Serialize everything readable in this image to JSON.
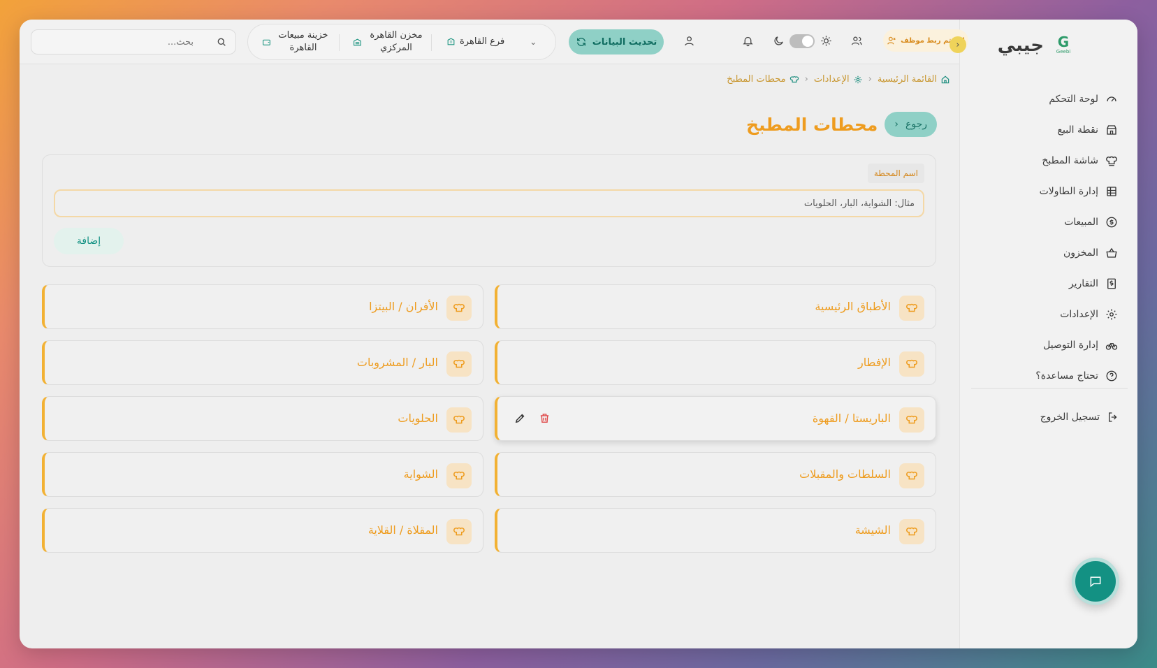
{
  "sidebar": {
    "brand": "جيبي",
    "logo_text": "Geebi",
    "items": [
      {
        "label": "لوحة التحكم",
        "icon": "gauge-icon"
      },
      {
        "label": "نقطة البيع",
        "icon": "store-icon"
      },
      {
        "label": "شاشة المطبخ",
        "icon": "chef-hat-icon"
      },
      {
        "label": "إدارة الطاولات",
        "icon": "table-icon"
      },
      {
        "label": "المبيعات",
        "icon": "dollar-circle-icon"
      },
      {
        "label": "المخزون",
        "icon": "basket-icon"
      },
      {
        "label": "التقارير",
        "icon": "receipt-icon"
      },
      {
        "label": "الإعدادات",
        "icon": "gear-icon"
      },
      {
        "label": "إدارة التوصيل",
        "icon": "bike-icon"
      },
      {
        "label": "تحتاج مساعدة؟",
        "icon": "help-circle-icon"
      }
    ],
    "logout": "تسجيل الخروج"
  },
  "topbar": {
    "search_placeholder": "بحث...",
    "context": {
      "treasury": "خزينة مبيعات القاهرة",
      "warehouse": "مخزن القاهرة المركزي",
      "branch": "فرع القاهرة"
    },
    "refresh_label": "تحديث البيانات",
    "unlinked_badge": "لم يتم ربط موظف"
  },
  "breadcrumb": {
    "home": "القائمة الرئيسية",
    "settings": "الإعدادات",
    "current": "محطات المطبخ"
  },
  "page": {
    "back_label": "رجوع",
    "title": "محطات المطبخ"
  },
  "form": {
    "label": "اسم المحطة",
    "placeholder": "مثال: الشواية، البار، الحلويات",
    "add_label": "إضافة"
  },
  "stations": [
    "الأطباق الرئيسية",
    "الأفران / البيتزا",
    "الإفطار",
    "البار / المشروبات",
    "الباريستا / القهوة",
    "الحلويات",
    "السلطات والمقبلات",
    "الشواية",
    "الشيشة",
    "المقلاة / القلاية"
  ],
  "colors": {
    "accent": "#ee9c1f",
    "teal": "#139183",
    "delete": "#e04848"
  }
}
